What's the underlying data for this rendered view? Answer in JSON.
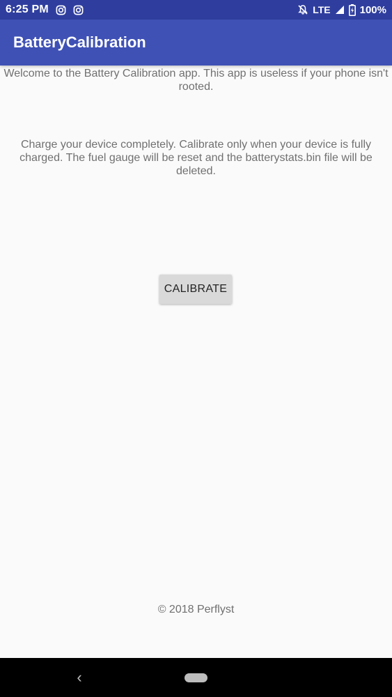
{
  "status_bar": {
    "time": "6:25 PM",
    "network": "LTE",
    "battery": "100%",
    "icons": [
      "instagram-icon",
      "instagram-icon",
      "notifications-off-icon",
      "signal-icon",
      "battery-charging-icon"
    ]
  },
  "app_bar": {
    "title": "BatteryCalibration"
  },
  "main": {
    "welcome_text": "Welcome to the Battery Calibration app. This app is useless if your phone isn't rooted.",
    "instructions_text": "Charge your device completely. Calibrate only when your device is fully charged. The fuel gauge will be reset and the batterystats.bin file will be deleted.",
    "calibrate_label": "CALIBRATE",
    "footer_text": "© 2018 Perflyst"
  },
  "nav_bar": {
    "back_glyph": "‹",
    "icons": [
      "back-icon",
      "home-pill-icon"
    ]
  },
  "colors": {
    "status_bar": "#2f3e9e",
    "app_bar": "#3f51b5",
    "background": "#fafafa",
    "body_text": "#707070",
    "button": "#d9d9d9"
  }
}
